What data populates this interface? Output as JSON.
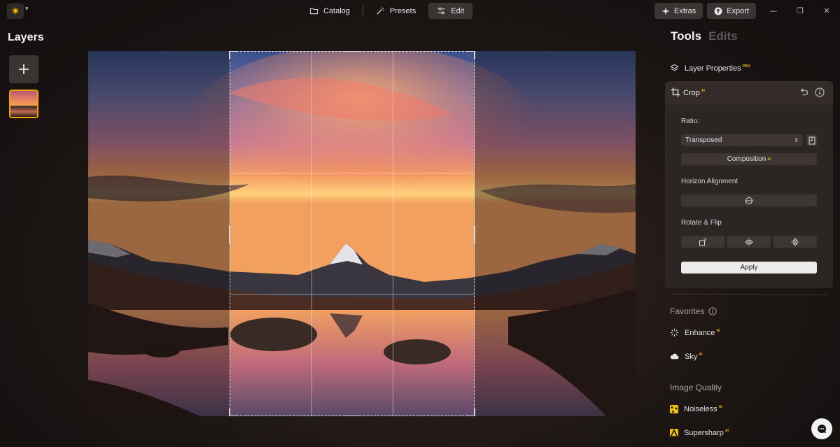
{
  "app": {
    "logo_icon": "sun-logo-icon",
    "menu_caret": "▾"
  },
  "nav": {
    "tabs": [
      {
        "label": "Catalog",
        "icon": "folder-icon"
      },
      {
        "label": "Presets",
        "icon": "magic-wand-icon"
      },
      {
        "label": "Edit",
        "icon": "sliders-icon",
        "active": true
      }
    ]
  },
  "actions": {
    "extras_label": "Extras",
    "export_label": "Export",
    "minimize": "—",
    "restore": "❐",
    "close": "✕"
  },
  "layers": {
    "title": "Layers",
    "add_symbol": "+"
  },
  "panel": {
    "tabs": [
      {
        "label": "Tools",
        "active": true
      },
      {
        "label": "Edits",
        "active": false
      }
    ],
    "layer_properties": {
      "label": "Layer Properties",
      "badge": "PRO"
    },
    "crop": {
      "label": "Crop",
      "badge": "AI",
      "ratio_label": "Ratio:",
      "ratio_value": "Transposed",
      "composition_label": "Composition",
      "composition_badge": "AI",
      "horizon_label": "Horizon Alignment",
      "rotate_label": "Rotate & Flip",
      "apply_label": "Apply"
    },
    "favorites": {
      "label": "Favorites",
      "items": [
        {
          "label": "Enhance",
          "badge": "AI",
          "icon": "sparkle-icon"
        },
        {
          "label": "Sky",
          "badge": "AI",
          "icon": "cloud-icon"
        }
      ]
    },
    "image_quality": {
      "label": "Image Quality",
      "items": [
        {
          "label": "Noiseless",
          "badge": "AI",
          "icon": "noiseless-icon"
        },
        {
          "label": "Supersharp",
          "badge": "AI",
          "icon": "supersharp-icon"
        }
      ]
    }
  },
  "colors": {
    "accent": "#f2b400",
    "panel_bg": "#2b2524",
    "control_bg": "#3d3634"
  }
}
